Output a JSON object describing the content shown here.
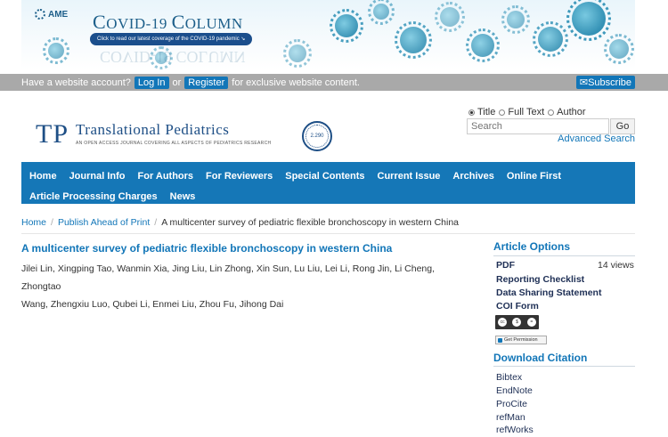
{
  "banner": {
    "publisher": "AME",
    "title_big": "C",
    "title_rest_1": "OVID-19 ",
    "title_big2": "C",
    "title_rest_2": "OLUMN",
    "cta": "Click to read our latest coverage of the COVID-19 pandemic",
    "reflection": "COVID-19 COLUMN"
  },
  "account": {
    "prompt": "Have a website account?",
    "login": "Log In",
    "or": "or",
    "register": "Register",
    "suffix": "for exclusive website content.",
    "subscribe": "Subscribe"
  },
  "journal": {
    "abbrev": "TP",
    "name": "Translational Pediatrics",
    "tagline": "AN OPEN ACCESS JOURNAL COVERING ALL ASPECTS OF PEDIATRICS RESEARCH",
    "seal_value": "2.290"
  },
  "search": {
    "options": [
      "Title",
      "Full Text",
      "Author"
    ],
    "selected": "Title",
    "placeholder": "Search",
    "go": "Go",
    "advanced": "Advanced Search"
  },
  "nav": {
    "row1": [
      "Home",
      "Journal Info",
      "For Authors",
      "For Reviewers",
      "Special Contents",
      "Current Issue",
      "Archives",
      "Online First"
    ],
    "row2": [
      "Article Processing Charges",
      "News"
    ]
  },
  "breadcrumb": [
    "Home",
    "Publish Ahead of Print",
    "A multicenter survey of pediatric flexible bronchoscopy in western China"
  ],
  "article": {
    "title": "A multicenter survey of pediatric flexible bronchoscopy in western China",
    "authors_line1": "Jilei Lin, Xingping Tao, Wanmin Xia, Jing Liu, Lin Zhong, Xin Sun, Lu Liu, Lei Li, Rong Jin, Li Cheng, Zhongtao",
    "authors_line2": "Wang, Zhengxiu Luo, Qubei Li, Enmei Liu, Zhou Fu, Jihong Dai"
  },
  "sidebar": {
    "options_heading": "Article Options",
    "options": [
      "PDF",
      "Reporting Checklist",
      "Data Sharing Statement",
      "COI Form"
    ],
    "views": "14 views",
    "get_permission": "Get Permission",
    "citation_heading": "Download Citation",
    "citations": [
      "Bibtex",
      "EndNote",
      "ProCite",
      "refMan",
      "refWorks"
    ]
  }
}
